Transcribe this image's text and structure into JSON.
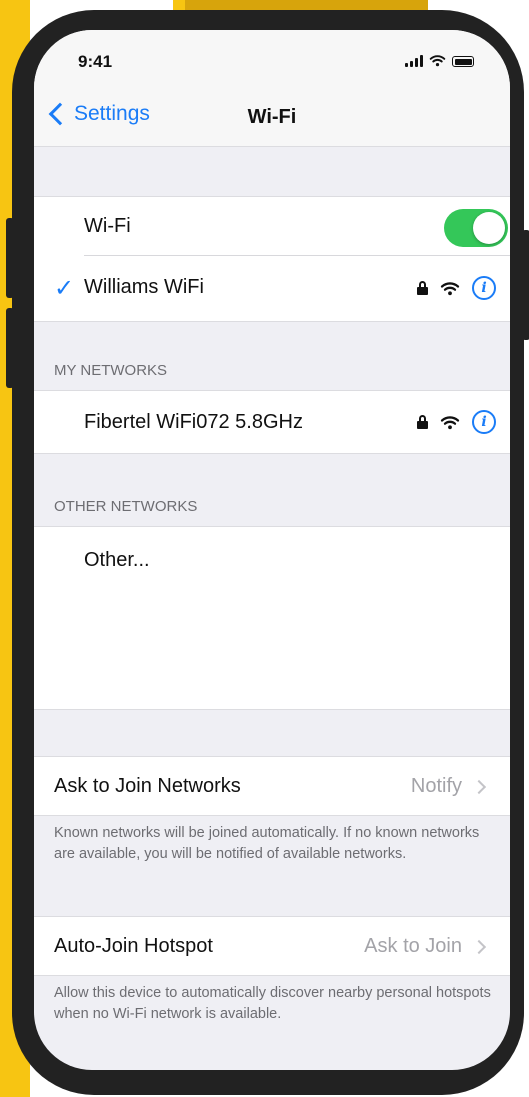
{
  "status_bar": {
    "time": "9:41"
  },
  "nav": {
    "back_label": "Settings",
    "title": "Wi-Fi"
  },
  "wifi": {
    "label": "Wi-Fi",
    "enabled": true,
    "connected_network": "Williams WiFi"
  },
  "my_networks": {
    "header": "MY NETWORKS",
    "items": [
      {
        "name": "Fibertel WiFi072 5.8GHz",
        "secured": true
      }
    ]
  },
  "other_networks": {
    "header": "OTHER NETWORKS",
    "other_label": "Other..."
  },
  "ask_to_join": {
    "label": "Ask to Join Networks",
    "value": "Notify",
    "footer": "Known networks will be joined automatically. If no known networks are available, you will be notified of available networks."
  },
  "auto_join": {
    "label": "Auto-Join Hotspot",
    "value": "Ask to Join",
    "footer": "Allow this device to automatically discover nearby personal hotspots when no Wi-Fi network is available."
  },
  "colors": {
    "accent": "#1a7cf7",
    "toggle_on": "#34c759",
    "frame_yellow": "#f7c512",
    "phone_frame": "#222222"
  },
  "icons": [
    "back-chevron-icon",
    "checkmark-icon",
    "lock-icon",
    "wifi-icon",
    "info-icon",
    "chevron-right-icon",
    "signal-icon",
    "battery-icon"
  ]
}
